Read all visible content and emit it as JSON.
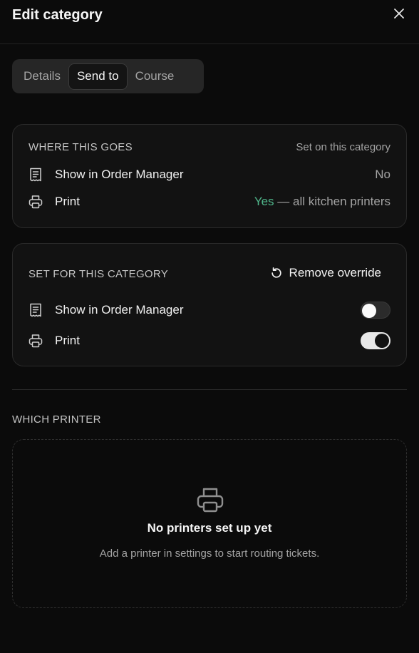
{
  "header": {
    "title": "Edit category"
  },
  "tabs": [
    {
      "label": "Details",
      "active": false
    },
    {
      "label": "Send to",
      "active": true
    },
    {
      "label": "Course",
      "active": false
    }
  ],
  "where_this_goes": {
    "label": "WHERE THIS GOES",
    "note": "Set on this category",
    "rows": [
      {
        "label": "Show in Order Manager",
        "value": "No",
        "icon": "receipt-icon"
      },
      {
        "label": "Print",
        "value_yes": "Yes",
        "value_rest": " — all kitchen printers",
        "icon": "printer-icon"
      }
    ]
  },
  "set_for_category": {
    "label": "SET FOR THIS CATEGORY",
    "remove_label": "Remove override",
    "rows": [
      {
        "label": "Show in Order Manager",
        "enabled": false,
        "icon": "receipt-icon"
      },
      {
        "label": "Print",
        "enabled": true,
        "icon": "printer-icon"
      }
    ]
  },
  "which_printer": {
    "label": "WHICH PRINTER",
    "empty_title": "No printers set up yet",
    "empty_subtitle": "Add a printer in settings to start routing tickets."
  },
  "colors": {
    "accent_yes": "#4fb58a",
    "background": "#0b0b0b"
  }
}
